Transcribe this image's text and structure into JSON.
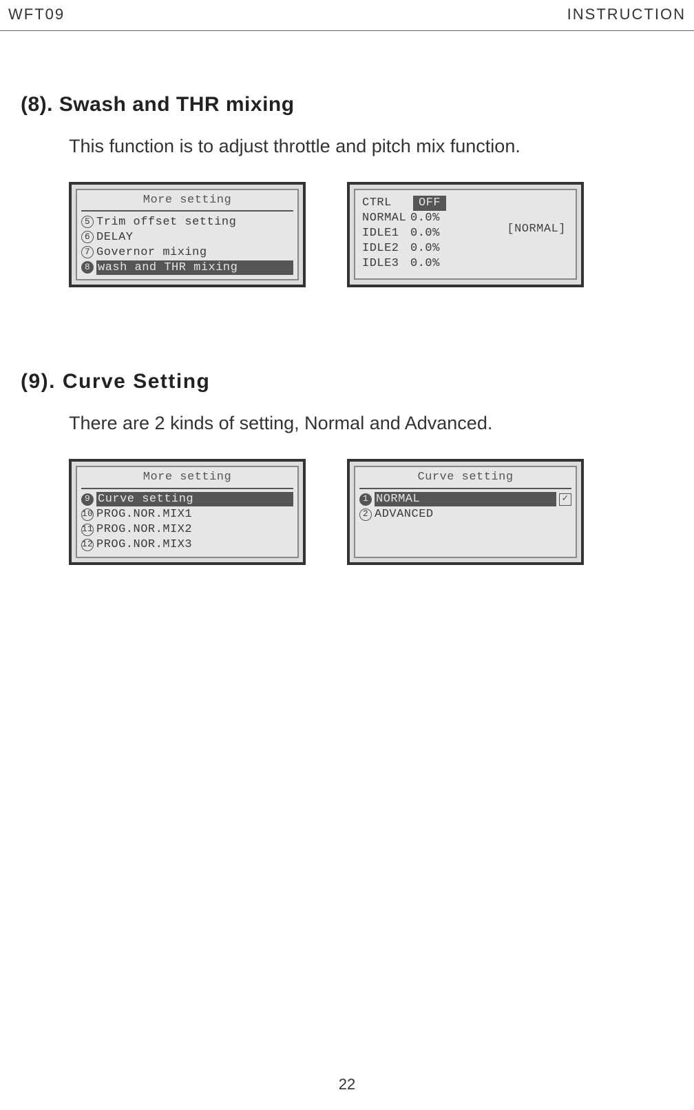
{
  "header": {
    "left": "WFT09",
    "right": "INSTRUCTION"
  },
  "section8": {
    "heading": "(8). Swash and THR mixing",
    "body": "This function is to adjust throttle and pitch mix function.",
    "screen1": {
      "title": "More setting",
      "items": [
        {
          "num": "5",
          "label": "Trim offset setting",
          "highlight": false
        },
        {
          "num": "6",
          "label": "DELAY",
          "highlight": false
        },
        {
          "num": "7",
          "label": "Governor mixing",
          "highlight": false
        },
        {
          "num": "8",
          "label": "wash and THR mixing",
          "highlight": true
        }
      ]
    },
    "screen2": {
      "ctrl_label": "CTRL",
      "ctrl_value": "OFF",
      "rows": [
        {
          "label": "NORMAL",
          "value": "0.0%"
        },
        {
          "label": " IDLE1",
          "value": "0.0%"
        },
        {
          "label": " IDLE2",
          "value": "0.0%"
        },
        {
          "label": " IDLE3",
          "value": "0.0%"
        }
      ],
      "mode": "[NORMAL]"
    }
  },
  "section9": {
    "heading": "(9). Curve Setting",
    "body": "There are 2 kinds of setting, Normal and Advanced.",
    "screen1": {
      "title": "More setting",
      "items": [
        {
          "num": "9",
          "label": "Curve setting",
          "highlight": true
        },
        {
          "num": "10",
          "label": "PROG.NOR.MIX1",
          "highlight": false
        },
        {
          "num": "11",
          "label": "PROG.NOR.MIX2",
          "highlight": false
        },
        {
          "num": "12",
          "label": "PROG.NOR.MIX3",
          "highlight": false
        }
      ]
    },
    "screen2": {
      "title": "Curve setting",
      "items": [
        {
          "num": "1",
          "label": "NORMAL",
          "highlight": true,
          "checked": true
        },
        {
          "num": "2",
          "label": "ADVANCED",
          "highlight": false,
          "checked": false
        }
      ]
    }
  },
  "page_number": "22"
}
